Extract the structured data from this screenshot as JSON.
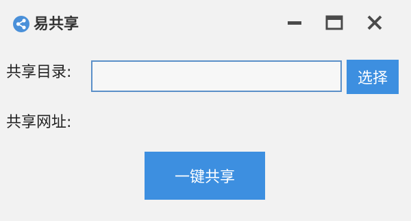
{
  "window": {
    "title": "易共享",
    "controls": {
      "minimize": "minimize-icon",
      "maximize": "maximize-icon",
      "close": "close-icon"
    }
  },
  "form": {
    "dir_label": "共享目录:",
    "dir_value": "",
    "select_button": "选择",
    "url_label": "共享网址:",
    "url_value": "",
    "share_button": "一键共享"
  },
  "colors": {
    "accent": "#3d8fe0",
    "input_border": "#5a8fc8",
    "background": "#f2f2f2"
  }
}
